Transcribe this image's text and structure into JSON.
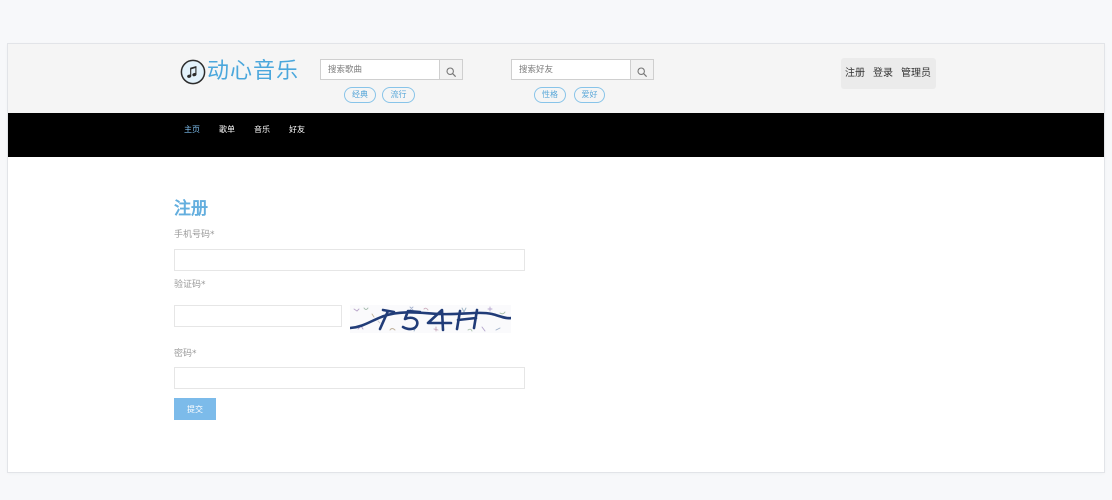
{
  "brand": {
    "name": "动心音乐"
  },
  "search_songs": {
    "placeholder": "搜索歌曲",
    "tags": [
      "经典",
      "流行"
    ]
  },
  "search_friends": {
    "placeholder": "搜索好友",
    "tags": [
      "性格",
      "爱好"
    ]
  },
  "account_menu": {
    "register": "注册",
    "login": "登录",
    "admin": "管理员"
  },
  "nav": {
    "items": [
      {
        "label": "主页",
        "active": true
      },
      {
        "label": "歌单",
        "active": false
      },
      {
        "label": "音乐",
        "active": false
      },
      {
        "label": "好友",
        "active": false
      }
    ]
  },
  "form": {
    "title": "注册",
    "phone": {
      "label": "手机号码*",
      "value": ""
    },
    "captcha": {
      "label": "验证码*",
      "value": ""
    },
    "password": {
      "label": "密码*",
      "value": ""
    },
    "submit_label": "提交"
  },
  "icons": {
    "logo": "music-note-icon",
    "search": "search-icon"
  },
  "colors": {
    "accent": "#4ba7dc",
    "nav_background": "#000000",
    "nav_active": "#7cbbea",
    "submit_button": "#7cbbea",
    "label_text": "#9a9a9a"
  }
}
